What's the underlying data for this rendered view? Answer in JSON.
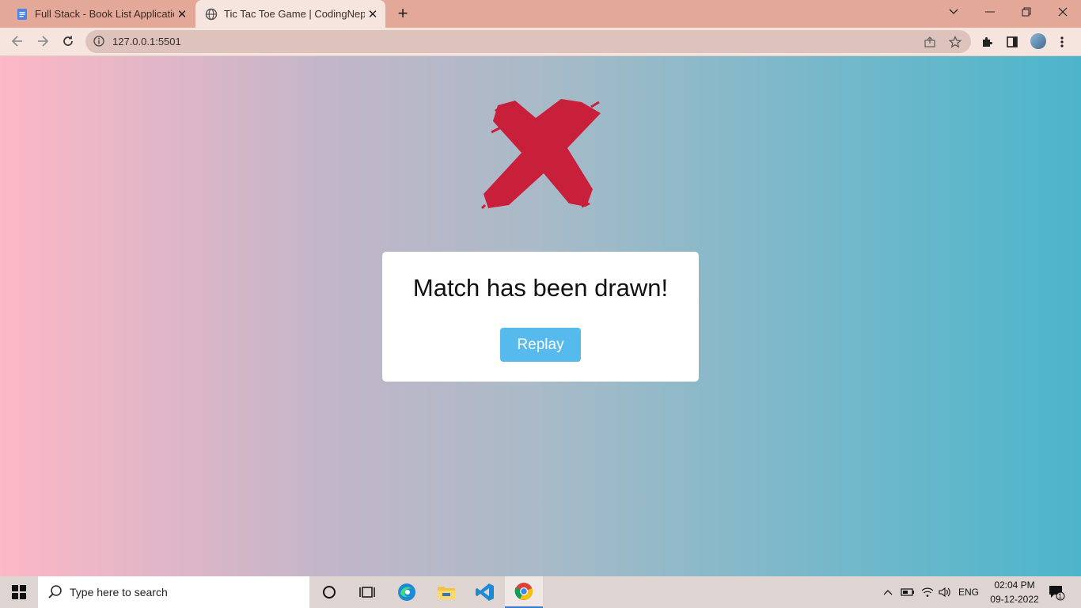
{
  "browser": {
    "tabs": [
      {
        "title": "Full Stack - Book List Application",
        "icon": "docs-icon"
      },
      {
        "title": "Tic Tac Toe Game | CodingNepal",
        "icon": "globe-icon"
      }
    ],
    "url": "127.0.0.1:5501"
  },
  "page": {
    "winner_mark": "X",
    "mark_color": "#c8203a",
    "result_message": "Match has been drawn!",
    "replay_label": "Replay",
    "button_color": "#56baec"
  },
  "taskbar": {
    "search_placeholder": "Type here to search",
    "language": "ENG",
    "time": "02:04 PM",
    "date": "09-12-2022",
    "notification_count": "1"
  }
}
